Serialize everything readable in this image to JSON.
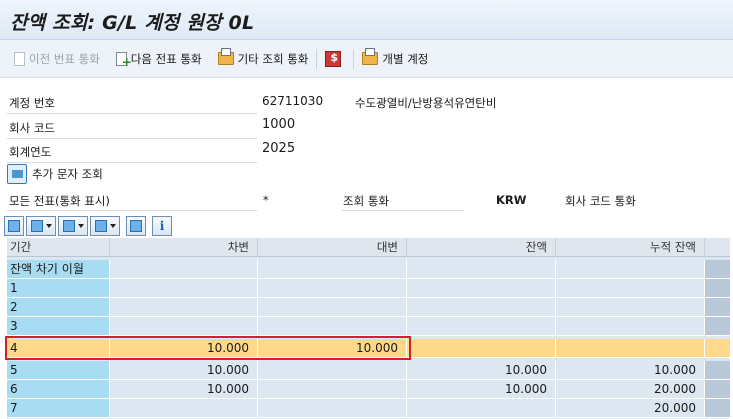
{
  "window": {
    "title": "잔액 조회: G/L 계정 원장 0L"
  },
  "toolbar": {
    "prev_doc": "이전 번표 통화",
    "next_doc": "다음 전표 통화",
    "other_currency": "기타 조회 통화",
    "individual_account": "개별 계정"
  },
  "header": {
    "account_label": "계정 번호",
    "account_value": "62711030",
    "account_desc": "수도광열비/난방용석유연탄비",
    "company_label": "회사 코드",
    "company_value": "1000",
    "fiscal_label": "회계연도",
    "fiscal_value": "2025",
    "additional_label": "추가 문자 조회",
    "all_docs_label": "모든 전표(통화 표시)",
    "all_docs_value": "*",
    "display_currency_label": "조회 통화",
    "display_currency_value": "KRW",
    "company_currency_label": "회사 코드 통화"
  },
  "table": {
    "columns": [
      "기간",
      "차변",
      "대변",
      "잔액",
      "누적 잔액"
    ],
    "rows": [
      {
        "period": "잔액 차기 이월",
        "debit": "",
        "credit": "",
        "balance": "",
        "cumulative": ""
      },
      {
        "period": "1",
        "debit": "",
        "credit": "",
        "balance": "",
        "cumulative": ""
      },
      {
        "period": "2",
        "debit": "",
        "credit": "",
        "balance": "",
        "cumulative": ""
      },
      {
        "period": "3",
        "debit": "",
        "credit": "",
        "balance": "",
        "cumulative": ""
      },
      {
        "period": "4",
        "debit": "10.000",
        "credit": "10.000",
        "balance": "",
        "cumulative": ""
      },
      {
        "period": "5",
        "debit": "10.000",
        "credit": "",
        "balance": "10.000",
        "cumulative": "10.000"
      },
      {
        "period": "6",
        "debit": "10.000",
        "credit": "",
        "balance": "10.000",
        "cumulative": "20.000"
      },
      {
        "period": "7",
        "debit": "",
        "credit": "",
        "balance": "",
        "cumulative": "20.000"
      }
    ]
  },
  "colors": {
    "highlight": "#ffd98a",
    "key_column": "#a8dcf3",
    "annotation": "#d71f26"
  }
}
